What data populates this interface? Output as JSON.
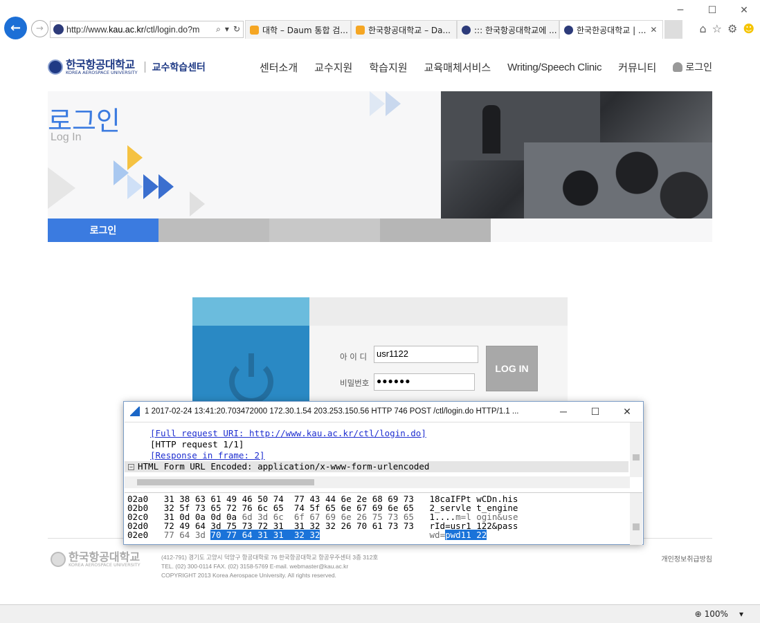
{
  "browser": {
    "url_prefix": "http://www.",
    "url_domain": "kau.ac.kr",
    "url_rest": "/ctl/login.do?m",
    "tabs": [
      {
        "label": "대학 – Daum 통합 검...",
        "color": "#f5a623"
      },
      {
        "label": "한국항공대학교 – Da...",
        "color": "#f5a623"
      },
      {
        "label": "::: 한국항공대학교에 ...",
        "color": "#2d3b7a"
      },
      {
        "label": "한국한공대학교 | ...",
        "color": "#2d3b7a"
      }
    ],
    "zoom": "100%",
    "window_controls": [
      "─",
      "☐",
      "✕"
    ]
  },
  "site": {
    "logo_ko": "한국항공대학교",
    "logo_en": "KOREA AEROSPACE UNIVERSITY",
    "center": "교수학습센터",
    "nav": [
      "센터소개",
      "교수지원",
      "학습지원",
      "교육매체서비스",
      "Writing/Speech Clinic",
      "커뮤니티"
    ],
    "login_link": "로그인"
  },
  "hero": {
    "title": "로그인",
    "subtitle": "Log In",
    "tab_active": "로그인"
  },
  "login": {
    "id_label": "아 이 디",
    "id_value": "usr1122",
    "pw_label": "비밀번호",
    "pw_value": "●●●●●●",
    "button": "LOG IN"
  },
  "footer": {
    "logo_ko": "한국항공대학교",
    "logo_en": "KOREA AEROSPACE UNIVERSITY",
    "addr1": "(412-791) 경기도 고양시 덕양구 항공대학로 76 한국항공대학교 항공우주센터 3층 312호",
    "addr2": "TEL. (02) 300-0114  FAX. (02) 3158-5769  E-mail. webmaster@kau.ac.kr",
    "addr3": "COPYRIGHT 2013 Korea Aerospace University. All rights reserved.",
    "privacy": "개인정보취급방침"
  },
  "wireshark": {
    "title": "1 2017-02-24 13:41:20.703472000 172.30.1.54 203.253.150.56 HTTP 746 POST /ctl/login.do HTTP/1.1 ...",
    "detail": {
      "full_uri": "[Full request URI: http://www.kau.ac.kr/ctl/login.do]",
      "request": "[HTTP request 1/1]",
      "response": "[Response in frame: 2]",
      "form_header": "HTML Form URL Encoded: application/x-www-form-urlencoded"
    },
    "hex_rows": [
      {
        "offset": "02a0",
        "bytes": "31 38 63 61 49 46 50 74  77 43 44 6e 2e 68 69 73",
        "ascii": "18caIFPt wCDn.his"
      },
      {
        "offset": "02b0",
        "bytes": "32 5f 73 65 72 76 6c 65  74 5f 65 6e 67 69 6e 65",
        "ascii": "2_servle t_engine"
      },
      {
        "offset": "02c0",
        "bytes_a": "31 0d 0a 0d 0a ",
        "bytes_b": "6d 3d 6c  6f 67 69 6e 26 75 73 65",
        "ascii_a": "1....",
        "ascii_b": "m=l ogin&use"
      },
      {
        "offset": "02d0",
        "bytes": "72 49 64 3d 75 73 72 31  31 32 32 26 70 61 73 73",
        "ascii": "rId=usr1 122&pass"
      },
      {
        "offset": "02e0",
        "bytes_a": "77 64 3d ",
        "bytes_b": "70 77 64 31 31  32 32",
        "ascii_a": "wd=",
        "ascii_b": "pwd11 22"
      }
    ]
  }
}
